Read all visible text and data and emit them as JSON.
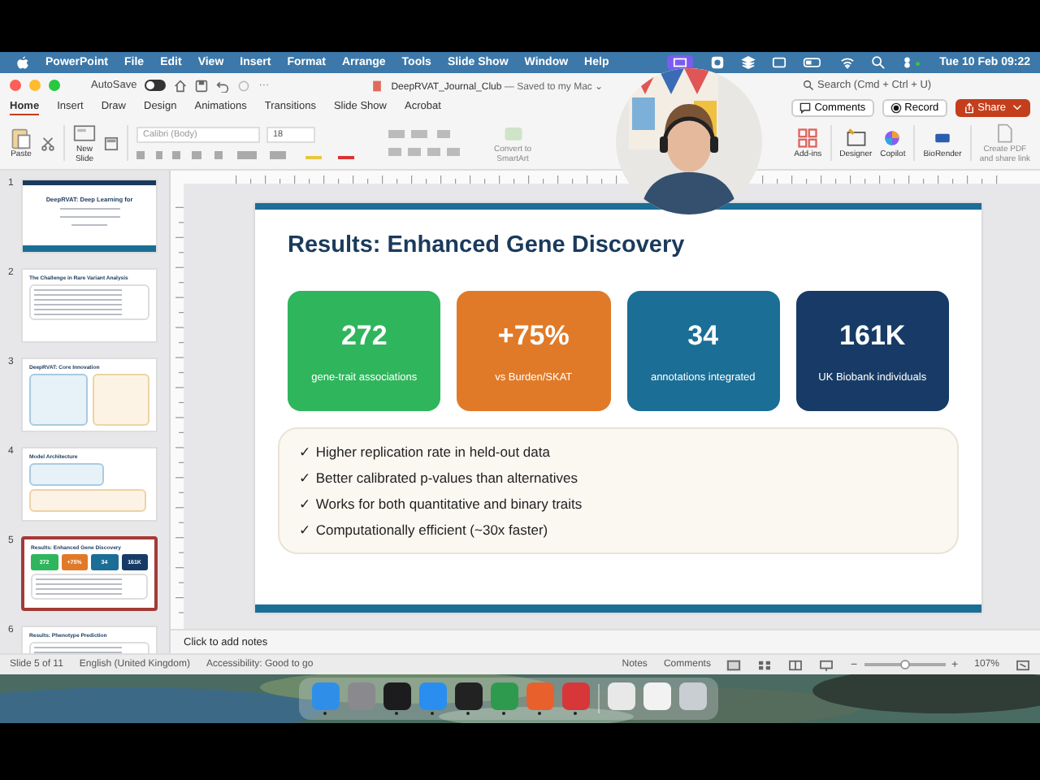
{
  "menu_bar": {
    "app": "PowerPoint",
    "items": [
      "File",
      "Edit",
      "View",
      "Insert",
      "Format",
      "Arrange",
      "Tools",
      "Slide Show",
      "Window",
      "Help"
    ],
    "clock": "Tue 10 Feb 09:22"
  },
  "window": {
    "autosave_label": "AutoSave",
    "autosave_on": false,
    "more": "···",
    "title": "DeepRVAT_Journal_Club",
    "saved": "— Saved to my Mac ⌄",
    "search": {
      "placeholder": "Search (Cmd + Ctrl + U)"
    }
  },
  "tabs": [
    {
      "label": "Home",
      "selected": true
    },
    {
      "label": "Insert",
      "selected": false
    },
    {
      "label": "Draw",
      "selected": false
    },
    {
      "label": "Design",
      "selected": false
    },
    {
      "label": "Animations",
      "selected": false
    },
    {
      "label": "Transitions",
      "selected": false
    },
    {
      "label": "Slide Show",
      "selected": false
    },
    {
      "label": "Acrobat",
      "selected": false
    }
  ],
  "header_buttons": {
    "comments": "Comments",
    "record": "Record",
    "share": "Share"
  },
  "ribbon": {
    "paste": "Paste",
    "new_slide": [
      "New",
      "Slide"
    ],
    "font": "Calibri (Body)",
    "size": "18",
    "smartart": [
      "Convert to",
      "SmartArt"
    ],
    "addins": "Add-ins",
    "designer": "Designer",
    "copilot": "Copilot",
    "biorender": "BioRender",
    "pdf": [
      "Create PDF",
      "and share link"
    ]
  },
  "thumbnails": [
    {
      "number": "1",
      "kind": "title",
      "title": "DeepRVAT: Deep Learning for",
      "selected": false
    },
    {
      "number": "2",
      "kind": "bullets",
      "title": "The Challenge in Rare Variant Analysis",
      "selected": false
    },
    {
      "number": "3",
      "kind": "columns",
      "title": "DeepRVAT: Core Innovation",
      "selected": false
    },
    {
      "number": "4",
      "kind": "boxes",
      "title": "Model Architecture",
      "selected": false
    },
    {
      "number": "5",
      "kind": "stats",
      "title": "Results: Enhanced Gene Discovery",
      "selected": true,
      "stats": [
        "272",
        "+75%",
        "34",
        "161K"
      ]
    },
    {
      "number": "6",
      "kind": "bullets",
      "title": "Results: Phenotype Prediction",
      "selected": false
    }
  ],
  "slide": {
    "title": "Results: Enhanced Gene Discovery",
    "cards": [
      {
        "value": "272",
        "label": "gene-trait associations",
        "color": "#2fb55c"
      },
      {
        "value": "+75%",
        "label": "vs Burden/SKAT",
        "color": "#e07a28"
      },
      {
        "value": "34",
        "label": "annotations integrated",
        "color": "#1b6e95"
      },
      {
        "value": "161K",
        "label": "UK Biobank individuals",
        "color": "#173b66"
      }
    ],
    "bullets": [
      "✓ Higher replication rate in held-out data",
      "✓ Better calibrated p-values than alternatives",
      "✓ Works for both quantitative and binary traits",
      "✓ Computationally efficient (~30x faster)"
    ]
  },
  "notes": {
    "placeholder": "Click to add notes"
  },
  "status_bar": {
    "slide": "Slide 5 of 11",
    "language": "English (United Kingdom)",
    "accessibility": "Accessibility: Good to go",
    "notes": "Notes",
    "comments": "Comments",
    "zoom": "107%",
    "zoom_out": "−",
    "zoom_in": "+",
    "zoom_slider": {
      "level": 0.5
    }
  },
  "dock": [
    {
      "kind": "finder",
      "running": true
    },
    {
      "kind": "settings",
      "running": false
    },
    {
      "kind": "terminal",
      "running": true
    },
    {
      "kind": "safari",
      "running": true
    },
    {
      "kind": "app",
      "running": true
    },
    {
      "kind": "excel",
      "running": true
    },
    {
      "kind": "firefox",
      "running": true
    },
    {
      "kind": "powerpoint",
      "running": true
    },
    {
      "kind": "drive",
      "running": false
    },
    {
      "kind": "document",
      "running": false
    },
    {
      "kind": "trash",
      "running": false
    }
  ]
}
